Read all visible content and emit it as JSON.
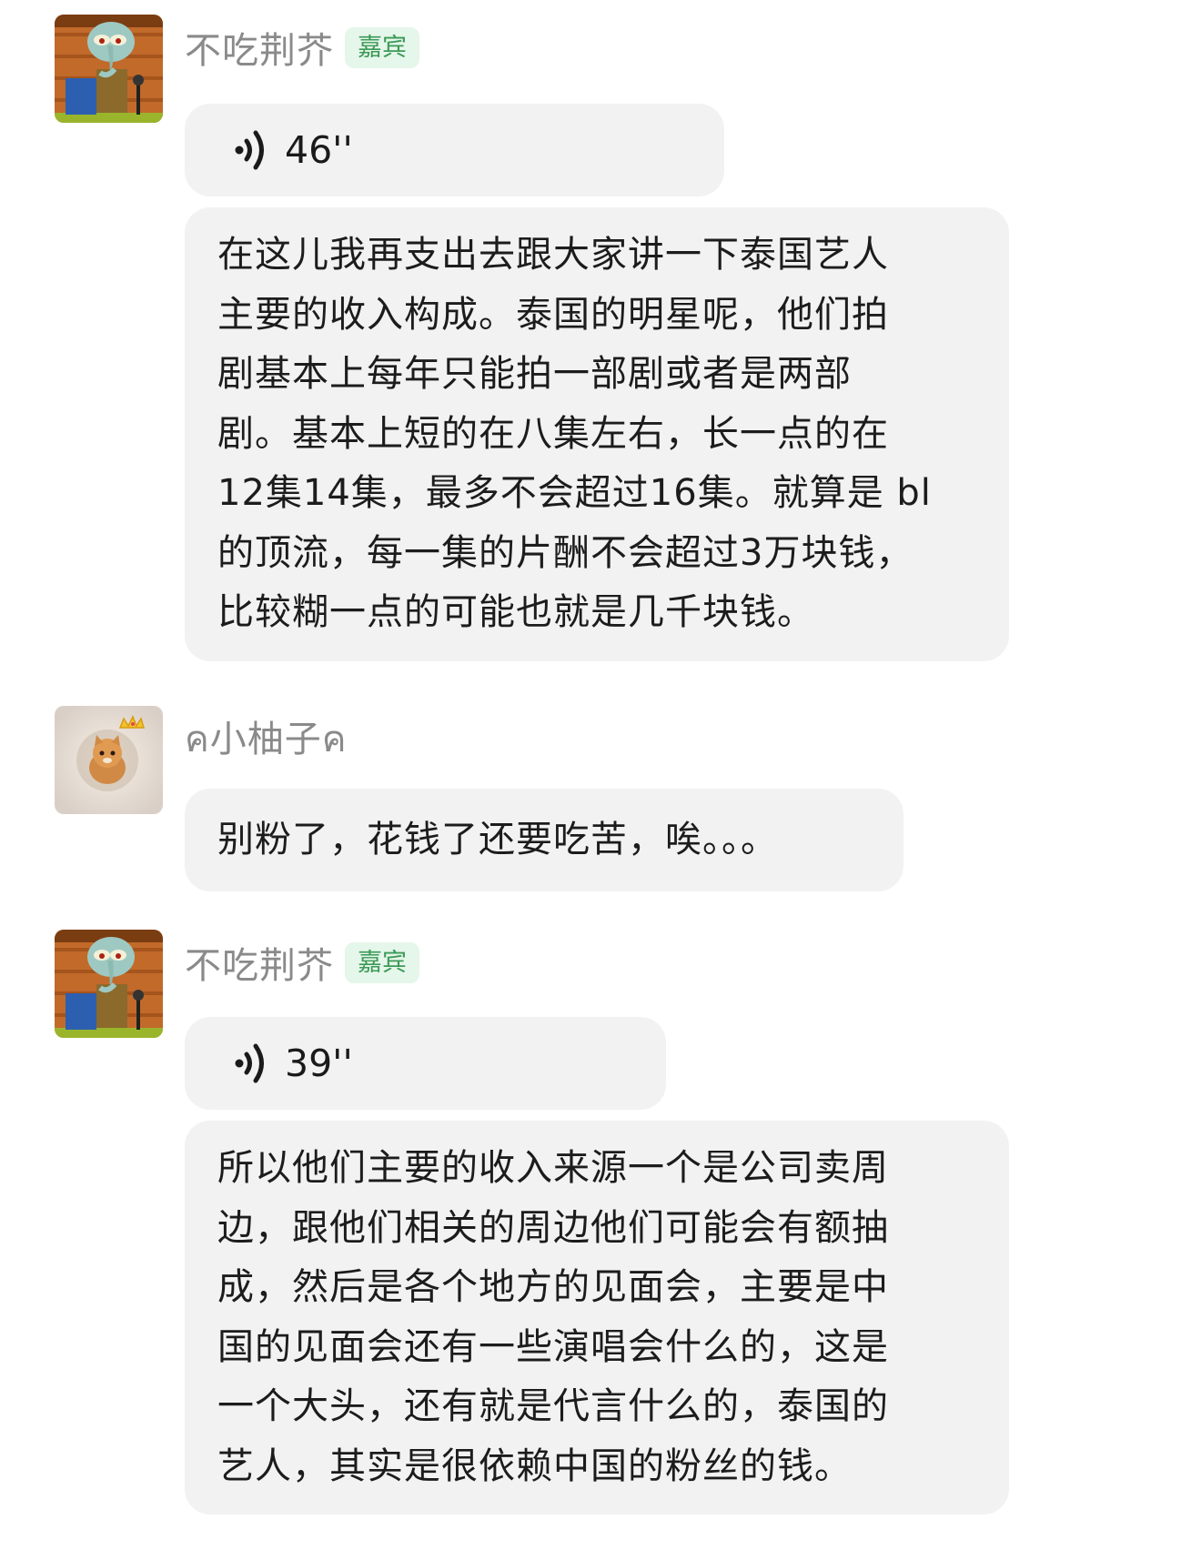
{
  "messages": [
    {
      "sender": "不吃荆芥",
      "badge": "嘉宾",
      "avatar": "squidward-avatar",
      "voice": "46''",
      "text_lines": [
        "在这儿我再支出去跟大家讲一下泰国艺人",
        "主要的收入构成。泰国的明星呢，他们拍",
        "剧基本上每年只能拍一部剧或者是两部",
        "剧。基本上短的在八集左右，长一点的在",
        "12集14集，最多不会超过16集。就算是 bl",
        "的顶流，每一集的片酬不会超过3万块钱，",
        "比较糊一点的可能也就是几千块钱。"
      ]
    },
    {
      "sender": "ค小柚子ค",
      "avatar": "cat-avatar",
      "text_lines": [
        "别粉了，花钱了还要吃苦，唉。。。"
      ]
    },
    {
      "sender": "不吃荆芥",
      "badge": "嘉宾",
      "avatar": "squidward-avatar",
      "voice": "39''",
      "text_lines": [
        "所以他们主要的收入来源一个是公司卖周",
        "边，跟他们相关的周边他们可能会有额抽",
        "成，然后是各个地方的见面会，主要是中",
        "国的见面会还有一些演唱会什么的，这是",
        "一个大头，还有就是代言什么的，泰国的",
        "艺人，其实是很依赖中国的粉丝的钱。"
      ]
    }
  ],
  "colors": {
    "bubble": "#f2f2f2",
    "name": "#8a8a8a",
    "badge_bg": "#e5f6ea",
    "badge_text": "#3c9a57"
  }
}
